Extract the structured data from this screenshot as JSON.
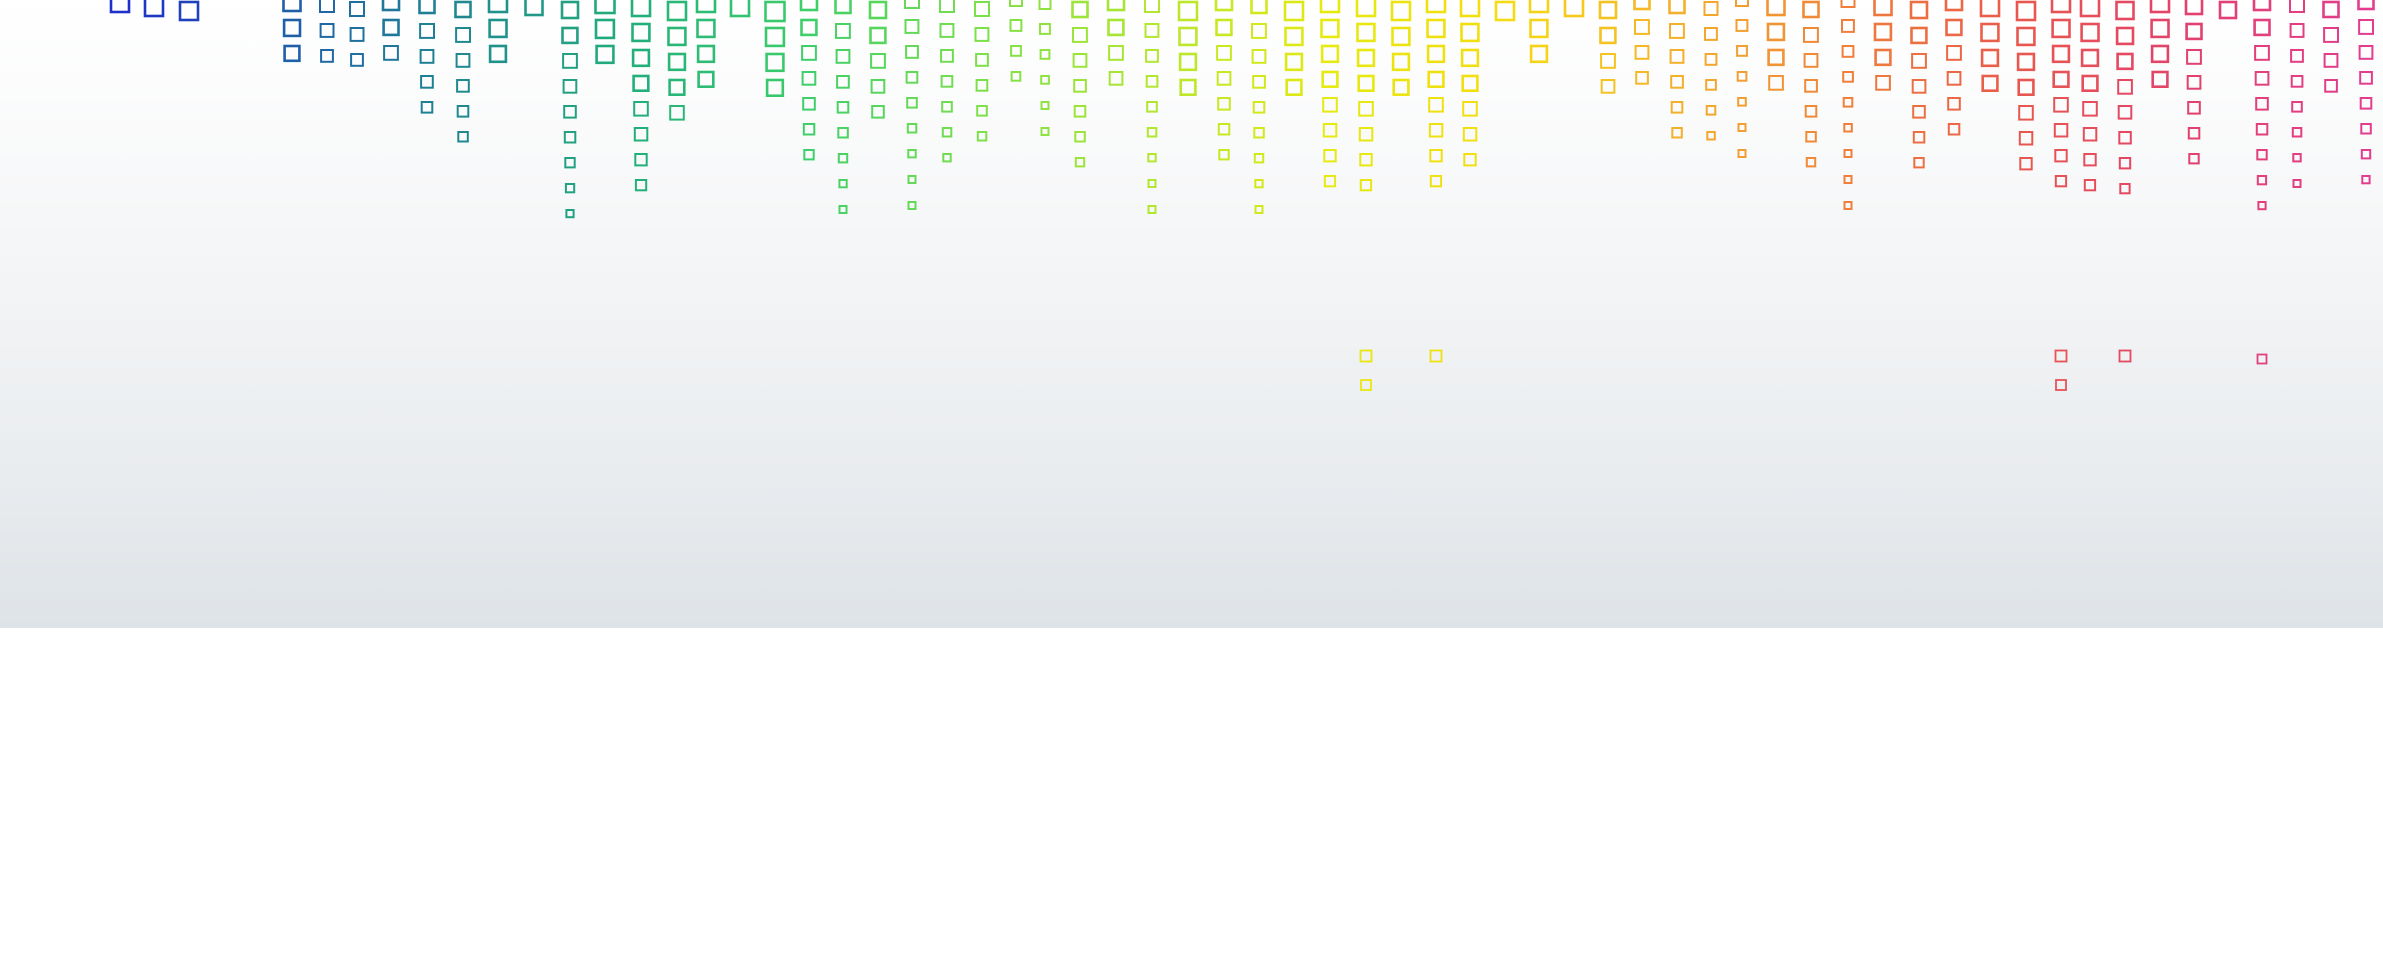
{
  "pattern": {
    "shape": "square-outline",
    "color_stops": [
      "#1f2fc9",
      "#1f5fa8",
      "#1f8a8f",
      "#22b07a",
      "#3fcf6a",
      "#7de04a",
      "#b4e62e",
      "#e6ea10",
      "#f5dc12",
      "#f4b12a",
      "#ef7f3a",
      "#e8584e",
      "#e2406e",
      "#e23d8e"
    ]
  },
  "background": {
    "top": "#ffffff",
    "bottom": "#dee3e7",
    "below": "#ffffff"
  }
}
